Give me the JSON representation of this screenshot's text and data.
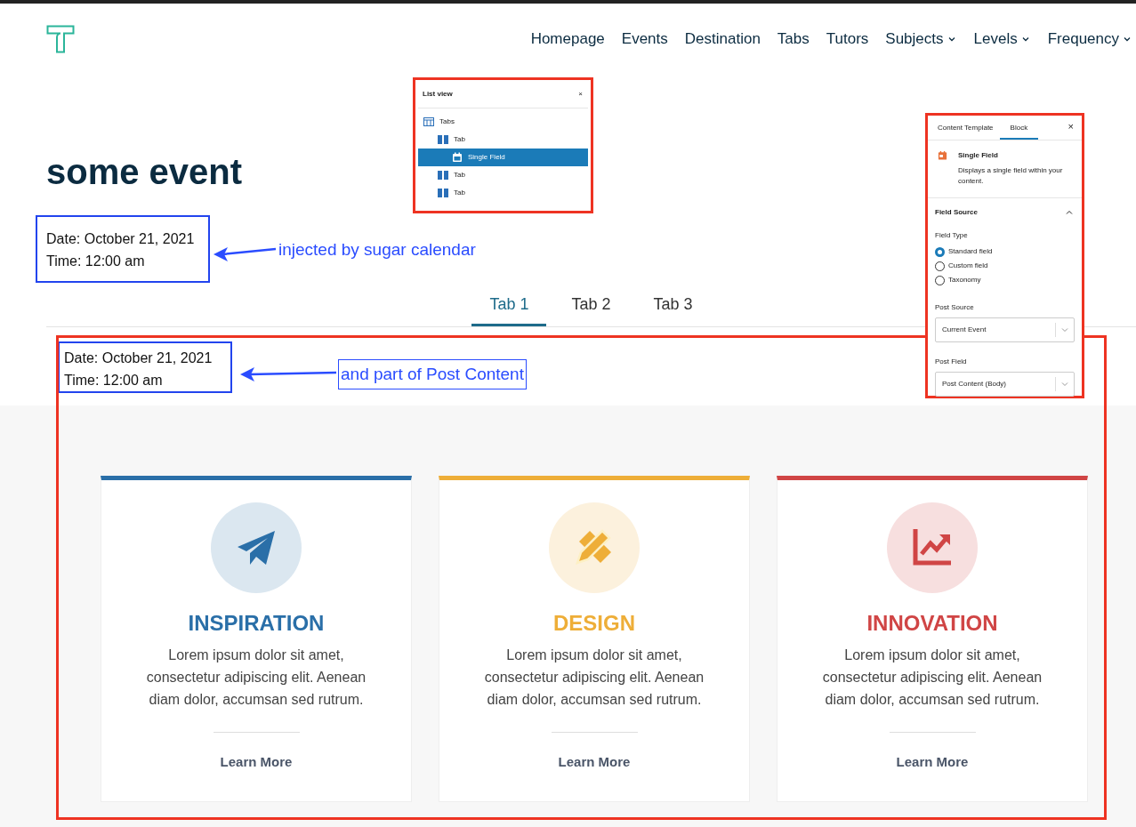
{
  "nav": {
    "items": [
      {
        "label": "Homepage",
        "has_menu": false
      },
      {
        "label": "Events",
        "has_menu": false
      },
      {
        "label": "Destination",
        "has_menu": false
      },
      {
        "label": "Tabs",
        "has_menu": false
      },
      {
        "label": "Tutors",
        "has_menu": false
      },
      {
        "label": "Subjects",
        "has_menu": true
      },
      {
        "label": "Levels",
        "has_menu": true
      },
      {
        "label": "Frequency",
        "has_menu": true
      }
    ]
  },
  "title": "some event",
  "injected_meta": {
    "date": "Date: October 21, 2021",
    "time": "Time: 12:00 am"
  },
  "tabs": [
    {
      "label": "Tab 1",
      "selected": true
    },
    {
      "label": "Tab 2",
      "selected": false
    },
    {
      "label": "Tab 3",
      "selected": false
    }
  ],
  "content_meta": {
    "date": "Date: October 21, 2021",
    "time": "Time: 12:00 am"
  },
  "annotations": [
    {
      "text": "injected by sugar calendar",
      "boxed": false
    },
    {
      "text": "and part of Post Content",
      "boxed": true
    }
  ],
  "features": [
    {
      "kind": "send",
      "title": "INSPIRATION",
      "color": "#2a6fa8",
      "text": "Lorem ipsum dolor sit amet, consectetur adipiscing elit. Aenean diam dolor, accumsan sed rutrum.",
      "link": "Learn More"
    },
    {
      "kind": "design",
      "title": "DESIGN",
      "color": "#eeae38",
      "text": "Lorem ipsum dolor sit amet, consectetur adipiscing elit. Aenean diam dolor, accumsan sed rutrum.",
      "link": "Learn More"
    },
    {
      "kind": "chart",
      "title": "INNOVATION",
      "color": "#d04545",
      "text": "Lorem ipsum dolor sit amet, consectetur adipiscing elit. Aenean diam dolor, accumsan sed rutrum.",
      "link": "Learn More"
    }
  ],
  "list_view": {
    "title": "List view",
    "close": "×",
    "items": [
      {
        "kind": "tabs",
        "label": "Tabs",
        "selected": false,
        "children": [
          {
            "kind": "tab",
            "label": "Tab",
            "selected": false,
            "children": [
              {
                "kind": "field",
                "label": "Single Field",
                "selected": true
              }
            ]
          },
          {
            "kind": "tab",
            "label": "Tab",
            "selected": false
          },
          {
            "kind": "tab",
            "label": "Tab",
            "selected": false
          }
        ]
      }
    ]
  },
  "block_panel": {
    "tabs": [
      {
        "label": "Content Template",
        "selected": false
      },
      {
        "label": "Block",
        "selected": true
      }
    ],
    "close": "×",
    "block": {
      "name": "Single Field",
      "description": "Displays a single field within your content."
    },
    "section": {
      "title": "Field Source",
      "expanded": true
    },
    "field_type": {
      "label": "Field Type",
      "options": [
        {
          "label": "Standard field",
          "selected": true
        },
        {
          "label": "Custom field",
          "selected": false
        },
        {
          "label": "Taxonomy",
          "selected": false
        }
      ]
    },
    "selects": [
      {
        "label": "Post Source",
        "value": "Current Event"
      },
      {
        "label": "Post Field",
        "value": "Post Content (Body)"
      }
    ]
  }
}
